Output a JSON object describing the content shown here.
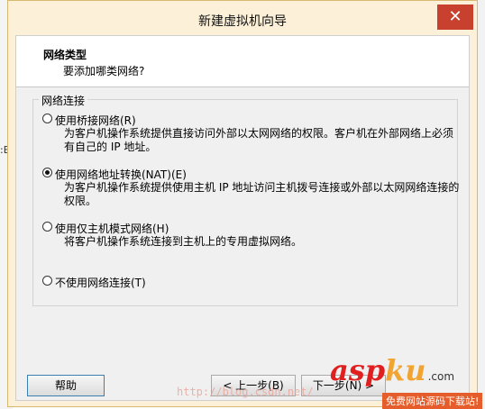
{
  "background": {
    "left_text": ":E"
  },
  "window": {
    "title": "新建虚拟机向导",
    "close_glyph": "✕",
    "colors": {
      "frame": "#fcf0d8",
      "close": "#c8412f",
      "client": "#f0f0f0"
    }
  },
  "header": {
    "title": "网络类型",
    "subtitle": "要添加哪类网络?"
  },
  "group": {
    "label": "网络连接",
    "options": [
      {
        "label": "使用桥接网络(R)",
        "checked": false,
        "desc": "为客户机操作系统提供直接访问外部以太网网络的权限。客户机在外部网络上必须有自己的 IP 地址。"
      },
      {
        "label": "使用网络地址转换(NAT)(E)",
        "checked": true,
        "desc": "为客户机操作系统提供使用主机 IP 地址访问主机拨号连接或外部以太网网络连接的权限。"
      },
      {
        "label": "使用仅主机模式网络(H)",
        "checked": false,
        "desc": "将客户机操作系统连接到主机上的专用虚拟网络。"
      },
      {
        "label": "不使用网络连接(T)",
        "checked": false,
        "desc": ""
      }
    ]
  },
  "footer": {
    "help": "帮助",
    "back": "< 上一步(B)",
    "next": "下一步(N) >"
  },
  "watermark": {
    "url": "http://blog.csdn.net/",
    "logo_asp": "asp",
    "logo_ku": "ku",
    "logo_com": ".com",
    "tagline": "免费网站源码下载站!"
  }
}
